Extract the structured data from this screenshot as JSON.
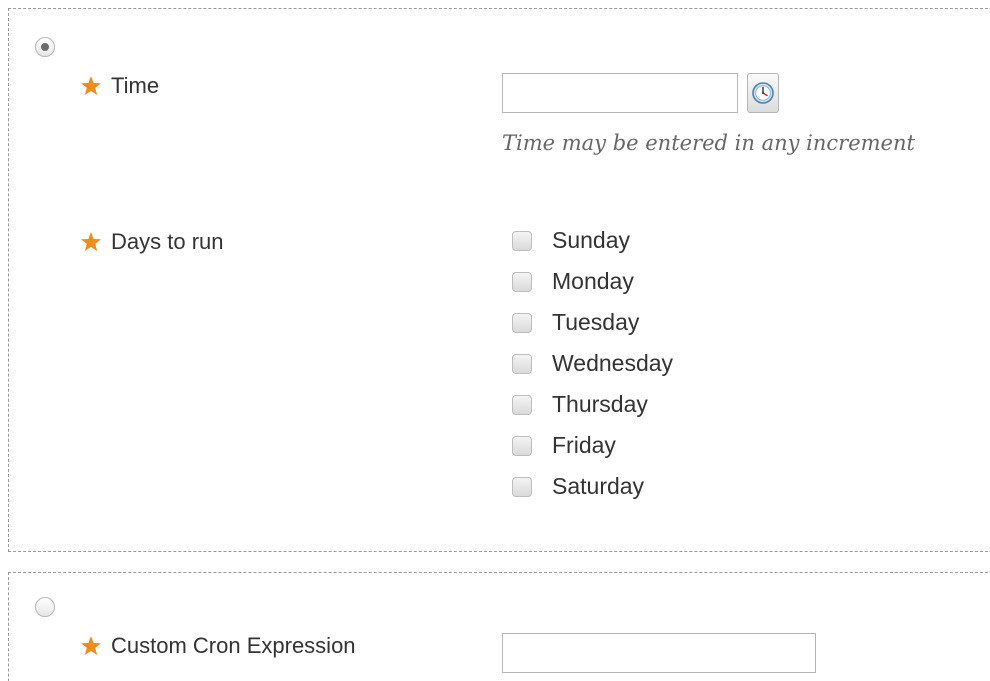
{
  "weekly_schedule": {
    "selected": true,
    "time_field": {
      "label": "Time",
      "value": "",
      "hint": "Time may be entered in any increment"
    },
    "days_field": {
      "label": "Days to run",
      "days": [
        {
          "label": "Sunday",
          "checked": false
        },
        {
          "label": "Monday",
          "checked": false
        },
        {
          "label": "Tuesday",
          "checked": false
        },
        {
          "label": "Wednesday",
          "checked": false
        },
        {
          "label": "Thursday",
          "checked": false
        },
        {
          "label": "Friday",
          "checked": false
        },
        {
          "label": "Saturday",
          "checked": false
        }
      ]
    }
  },
  "cron_schedule": {
    "selected": false,
    "cron_field": {
      "label": "Custom Cron Expression",
      "value": ""
    }
  },
  "icons": {
    "required": "required-star-icon",
    "time_picker": "clock-icon"
  },
  "colors": {
    "required_star": "#f08c1a",
    "border": "#9a9a9a",
    "hint_text": "#666666"
  }
}
